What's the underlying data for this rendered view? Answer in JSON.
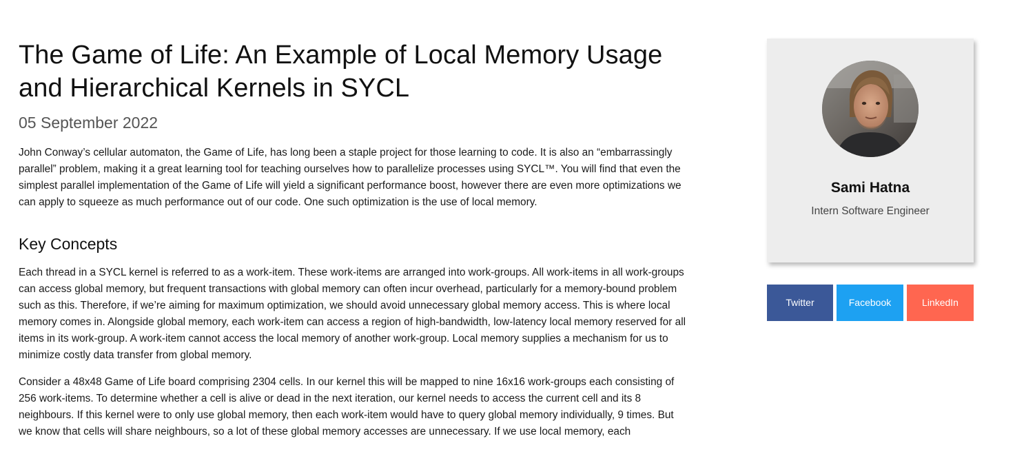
{
  "article": {
    "title": "The Game of Life: An Example of Local Memory Usage and Hierarchical Kernels in SYCL",
    "date": "05 September 2022",
    "intro": "John Conway’s cellular automaton, the Game of Life, has long been a staple project for those learning to code. It is also an “embarrassingly parallel” problem, making it a great learning tool for teaching ourselves how to parallelize processes using SYCL™. You will find that even the simplest parallel implementation of the Game of Life will yield a significant performance boost, however there are even more optimizations we can apply to squeeze as much performance out of our code. One such optimization is the use of local memory.",
    "section_heading": "Key Concepts",
    "paragraph_1": "Each thread in a SYCL kernel is referred to as a work-item. These work-items are arranged into work-groups. All work-items in all work-groups can access global memory, but frequent transactions with global memory can often incur overhead, particularly for a memory-bound problem such as this. Therefore, if we’re aiming for maximum optimization, we should avoid unnecessary global memory access. This is where local memory comes in. Alongside global memory, each work-item can access a region of high-bandwidth, low-latency local memory reserved for all items in its work-group. A work-item cannot access the local memory of another work-group. Local memory supplies a mechanism for us to minimize costly data transfer from global memory.",
    "paragraph_2": "Consider a 48x48 Game of Life board comprising 2304 cells. In our kernel this will be mapped to nine 16x16 work-groups each consisting of 256 work-items. To determine whether a cell is alive or dead in the next iteration, our kernel needs to access the current cell and its 8 neighbours. If this kernel were to only use global memory, then each work-item would have to query global memory individually, 9 times. But we know that cells will share neighbours, so a lot of these global memory accesses are unnecessary. If we use local memory, each"
  },
  "author": {
    "name": "Sami Hatna",
    "role": "Intern Software Engineer",
    "avatar_icon": "person-photo"
  },
  "share": {
    "twitter_label": "Twitter",
    "facebook_label": "Facebook",
    "linkedin_label": "LinkedIn",
    "colors": {
      "twitter": "#3b5898",
      "facebook": "#1da1f2",
      "linkedin": "#ff6650"
    }
  }
}
